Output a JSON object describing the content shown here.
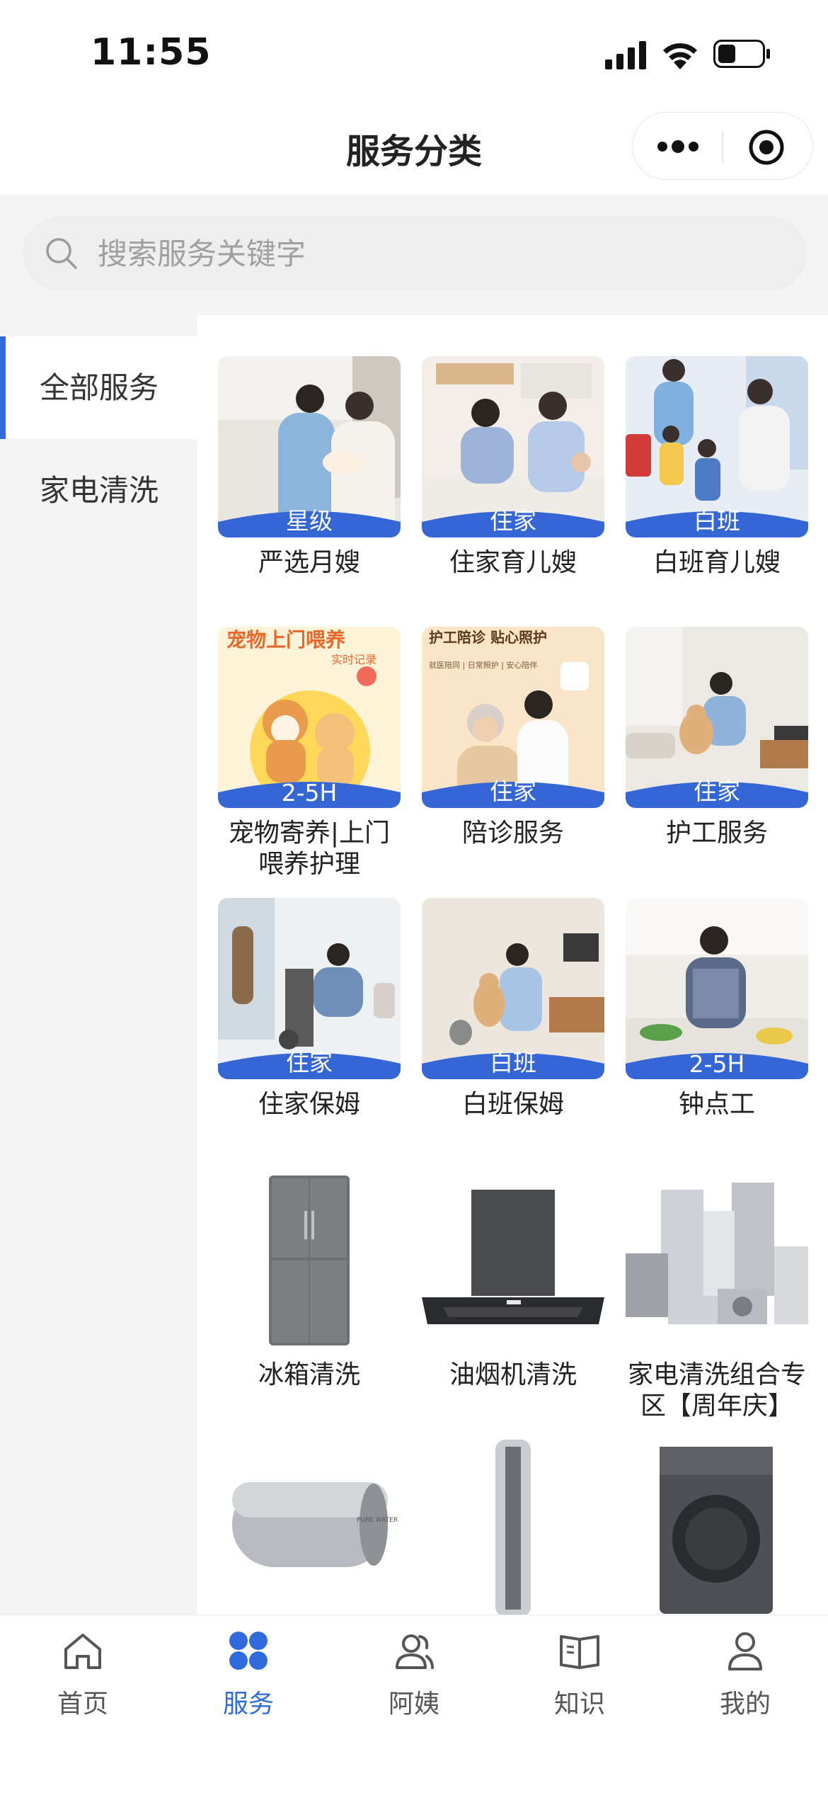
{
  "status_bar": {
    "time": "11:55"
  },
  "nav": {
    "title": "服务分类"
  },
  "search": {
    "placeholder": "搜索服务关键字"
  },
  "sidebar": {
    "items": [
      {
        "label": "全部服务",
        "active": true
      },
      {
        "label": "家电清洗",
        "active": false
      }
    ]
  },
  "grid": {
    "items": [
      {
        "label": "严选月嫂",
        "badge": "星级"
      },
      {
        "label": "住家育儿嫂",
        "badge": "住家"
      },
      {
        "label": "白班育儿嫂",
        "badge": "白班"
      },
      {
        "label": "宠物寄养|上门喂养护理",
        "badge": "2-5H"
      },
      {
        "label": "陪诊服务",
        "badge": "住家"
      },
      {
        "label": "护工服务",
        "badge": "住家"
      },
      {
        "label": "住家保姆",
        "badge": "住家"
      },
      {
        "label": "白班保姆",
        "badge": "白班"
      },
      {
        "label": "钟点工",
        "badge": "2-5H"
      },
      {
        "label": "冰箱清洗",
        "badge": ""
      },
      {
        "label": "油烟机清洗",
        "badge": ""
      },
      {
        "label": "家电清洗组合专区【周年庆】",
        "badge": ""
      },
      {
        "label": "",
        "badge": ""
      },
      {
        "label": "",
        "badge": ""
      },
      {
        "label": "",
        "badge": ""
      }
    ],
    "image_texts": {
      "pet_banner": "宠物上门喂养",
      "pet_sub": "实时记录",
      "escort_banner": "护工陪诊 贴心照护",
      "escort_sub": "就医陪同 | 日常照护 | 安心陪伴",
      "heater_brand": "PURE WATER"
    }
  },
  "tab_bar": {
    "tabs": [
      {
        "label": "首页",
        "icon": "home-icon"
      },
      {
        "label": "服务",
        "icon": "grid-icon",
        "active": true
      },
      {
        "label": "阿姨",
        "icon": "people-icon"
      },
      {
        "label": "知识",
        "icon": "book-icon"
      },
      {
        "label": "我的",
        "icon": "person-icon"
      }
    ]
  },
  "colors": {
    "accent": "#2f6bdc",
    "badge": "#3466d6",
    "sidebar_bg": "#f4f4f5"
  }
}
